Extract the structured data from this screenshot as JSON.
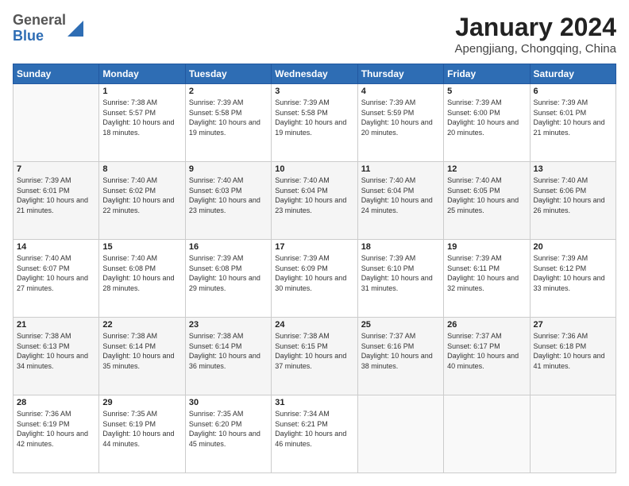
{
  "header": {
    "logo_general": "General",
    "logo_blue": "Blue",
    "month_title": "January 2024",
    "location": "Apengjiang, Chongqing, China"
  },
  "weekdays": [
    "Sunday",
    "Monday",
    "Tuesday",
    "Wednesday",
    "Thursday",
    "Friday",
    "Saturday"
  ],
  "weeks": [
    [
      {
        "num": "",
        "sunrise": "",
        "sunset": "",
        "daylight": "",
        "empty": true
      },
      {
        "num": "1",
        "sunrise": "Sunrise: 7:38 AM",
        "sunset": "Sunset: 5:57 PM",
        "daylight": "Daylight: 10 hours and 18 minutes."
      },
      {
        "num": "2",
        "sunrise": "Sunrise: 7:39 AM",
        "sunset": "Sunset: 5:58 PM",
        "daylight": "Daylight: 10 hours and 19 minutes."
      },
      {
        "num": "3",
        "sunrise": "Sunrise: 7:39 AM",
        "sunset": "Sunset: 5:58 PM",
        "daylight": "Daylight: 10 hours and 19 minutes."
      },
      {
        "num": "4",
        "sunrise": "Sunrise: 7:39 AM",
        "sunset": "Sunset: 5:59 PM",
        "daylight": "Daylight: 10 hours and 20 minutes."
      },
      {
        "num": "5",
        "sunrise": "Sunrise: 7:39 AM",
        "sunset": "Sunset: 6:00 PM",
        "daylight": "Daylight: 10 hours and 20 minutes."
      },
      {
        "num": "6",
        "sunrise": "Sunrise: 7:39 AM",
        "sunset": "Sunset: 6:01 PM",
        "daylight": "Daylight: 10 hours and 21 minutes."
      }
    ],
    [
      {
        "num": "7",
        "sunrise": "Sunrise: 7:39 AM",
        "sunset": "Sunset: 6:01 PM",
        "daylight": "Daylight: 10 hours and 21 minutes."
      },
      {
        "num": "8",
        "sunrise": "Sunrise: 7:40 AM",
        "sunset": "Sunset: 6:02 PM",
        "daylight": "Daylight: 10 hours and 22 minutes."
      },
      {
        "num": "9",
        "sunrise": "Sunrise: 7:40 AM",
        "sunset": "Sunset: 6:03 PM",
        "daylight": "Daylight: 10 hours and 23 minutes."
      },
      {
        "num": "10",
        "sunrise": "Sunrise: 7:40 AM",
        "sunset": "Sunset: 6:04 PM",
        "daylight": "Daylight: 10 hours and 23 minutes."
      },
      {
        "num": "11",
        "sunrise": "Sunrise: 7:40 AM",
        "sunset": "Sunset: 6:04 PM",
        "daylight": "Daylight: 10 hours and 24 minutes."
      },
      {
        "num": "12",
        "sunrise": "Sunrise: 7:40 AM",
        "sunset": "Sunset: 6:05 PM",
        "daylight": "Daylight: 10 hours and 25 minutes."
      },
      {
        "num": "13",
        "sunrise": "Sunrise: 7:40 AM",
        "sunset": "Sunset: 6:06 PM",
        "daylight": "Daylight: 10 hours and 26 minutes."
      }
    ],
    [
      {
        "num": "14",
        "sunrise": "Sunrise: 7:40 AM",
        "sunset": "Sunset: 6:07 PM",
        "daylight": "Daylight: 10 hours and 27 minutes."
      },
      {
        "num": "15",
        "sunrise": "Sunrise: 7:40 AM",
        "sunset": "Sunset: 6:08 PM",
        "daylight": "Daylight: 10 hours and 28 minutes."
      },
      {
        "num": "16",
        "sunrise": "Sunrise: 7:39 AM",
        "sunset": "Sunset: 6:08 PM",
        "daylight": "Daylight: 10 hours and 29 minutes."
      },
      {
        "num": "17",
        "sunrise": "Sunrise: 7:39 AM",
        "sunset": "Sunset: 6:09 PM",
        "daylight": "Daylight: 10 hours and 30 minutes."
      },
      {
        "num": "18",
        "sunrise": "Sunrise: 7:39 AM",
        "sunset": "Sunset: 6:10 PM",
        "daylight": "Daylight: 10 hours and 31 minutes."
      },
      {
        "num": "19",
        "sunrise": "Sunrise: 7:39 AM",
        "sunset": "Sunset: 6:11 PM",
        "daylight": "Daylight: 10 hours and 32 minutes."
      },
      {
        "num": "20",
        "sunrise": "Sunrise: 7:39 AM",
        "sunset": "Sunset: 6:12 PM",
        "daylight": "Daylight: 10 hours and 33 minutes."
      }
    ],
    [
      {
        "num": "21",
        "sunrise": "Sunrise: 7:38 AM",
        "sunset": "Sunset: 6:13 PM",
        "daylight": "Daylight: 10 hours and 34 minutes."
      },
      {
        "num": "22",
        "sunrise": "Sunrise: 7:38 AM",
        "sunset": "Sunset: 6:14 PM",
        "daylight": "Daylight: 10 hours and 35 minutes."
      },
      {
        "num": "23",
        "sunrise": "Sunrise: 7:38 AM",
        "sunset": "Sunset: 6:14 PM",
        "daylight": "Daylight: 10 hours and 36 minutes."
      },
      {
        "num": "24",
        "sunrise": "Sunrise: 7:38 AM",
        "sunset": "Sunset: 6:15 PM",
        "daylight": "Daylight: 10 hours and 37 minutes."
      },
      {
        "num": "25",
        "sunrise": "Sunrise: 7:37 AM",
        "sunset": "Sunset: 6:16 PM",
        "daylight": "Daylight: 10 hours and 38 minutes."
      },
      {
        "num": "26",
        "sunrise": "Sunrise: 7:37 AM",
        "sunset": "Sunset: 6:17 PM",
        "daylight": "Daylight: 10 hours and 40 minutes."
      },
      {
        "num": "27",
        "sunrise": "Sunrise: 7:36 AM",
        "sunset": "Sunset: 6:18 PM",
        "daylight": "Daylight: 10 hours and 41 minutes."
      }
    ],
    [
      {
        "num": "28",
        "sunrise": "Sunrise: 7:36 AM",
        "sunset": "Sunset: 6:19 PM",
        "daylight": "Daylight: 10 hours and 42 minutes."
      },
      {
        "num": "29",
        "sunrise": "Sunrise: 7:35 AM",
        "sunset": "Sunset: 6:19 PM",
        "daylight": "Daylight: 10 hours and 44 minutes."
      },
      {
        "num": "30",
        "sunrise": "Sunrise: 7:35 AM",
        "sunset": "Sunset: 6:20 PM",
        "daylight": "Daylight: 10 hours and 45 minutes."
      },
      {
        "num": "31",
        "sunrise": "Sunrise: 7:34 AM",
        "sunset": "Sunset: 6:21 PM",
        "daylight": "Daylight: 10 hours and 46 minutes."
      },
      {
        "num": "",
        "sunrise": "",
        "sunset": "",
        "daylight": "",
        "empty": true
      },
      {
        "num": "",
        "sunrise": "",
        "sunset": "",
        "daylight": "",
        "empty": true
      },
      {
        "num": "",
        "sunrise": "",
        "sunset": "",
        "daylight": "",
        "empty": true
      }
    ]
  ]
}
